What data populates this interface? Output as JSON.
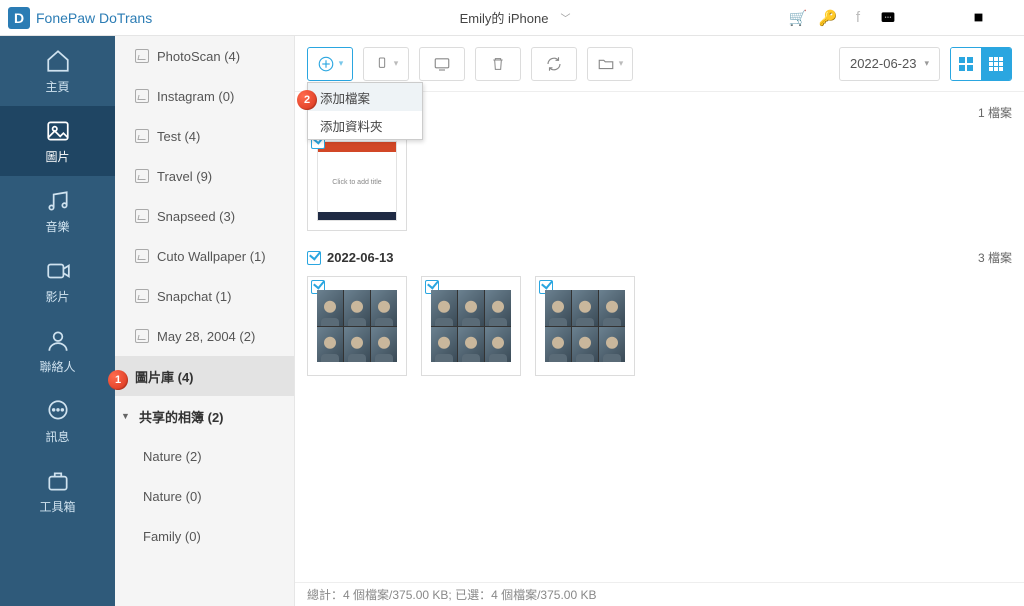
{
  "app": {
    "title": "FonePaw DoTrans"
  },
  "device": {
    "label": "Emily的 iPhone"
  },
  "nav": [
    {
      "label": "主頁"
    },
    {
      "label": "圖片"
    },
    {
      "label": "音樂"
    },
    {
      "label": "影片"
    },
    {
      "label": "聯絡人"
    },
    {
      "label": "訊息"
    },
    {
      "label": "工具箱"
    }
  ],
  "albums": [
    {
      "label": "PhotoScan (4)"
    },
    {
      "label": "Instagram (0)"
    },
    {
      "label": "Test (4)"
    },
    {
      "label": "Travel (9)"
    },
    {
      "label": "Snapseed (3)"
    },
    {
      "label": "Cuto Wallpaper (1)"
    },
    {
      "label": "Snapchat (1)"
    },
    {
      "label": "May 28, 2004 (2)"
    }
  ],
  "library": {
    "label": "圖片庫 (4)"
  },
  "shared": {
    "label": "共享的相簿 (2)",
    "children": [
      {
        "label": "Nature (2)"
      },
      {
        "label": "Nature (0)"
      },
      {
        "label": "Family (0)"
      }
    ]
  },
  "toolbar": {
    "date": "2022-06-23",
    "addMenu": {
      "addFile": "添加檔案",
      "addFolder": "添加資料夾"
    }
  },
  "groups": [
    {
      "date": "2022-06-23",
      "countLabel": "1 檔案",
      "thumbs": [
        "pptx"
      ]
    },
    {
      "date": "2022-06-13",
      "countLabel": "3 檔案",
      "thumbs": [
        "vconf",
        "vconf",
        "vconf"
      ]
    }
  ],
  "status": {
    "totalPrefix": "總計：",
    "totalValue": "4 個檔案/375.00 KB",
    "selectedPrefix": "; 已選：",
    "selectedValue": "4 個檔案/375.00 KB"
  },
  "badges": {
    "b1": "1",
    "b2": "2"
  },
  "slide_placeholder": "Click to add title"
}
